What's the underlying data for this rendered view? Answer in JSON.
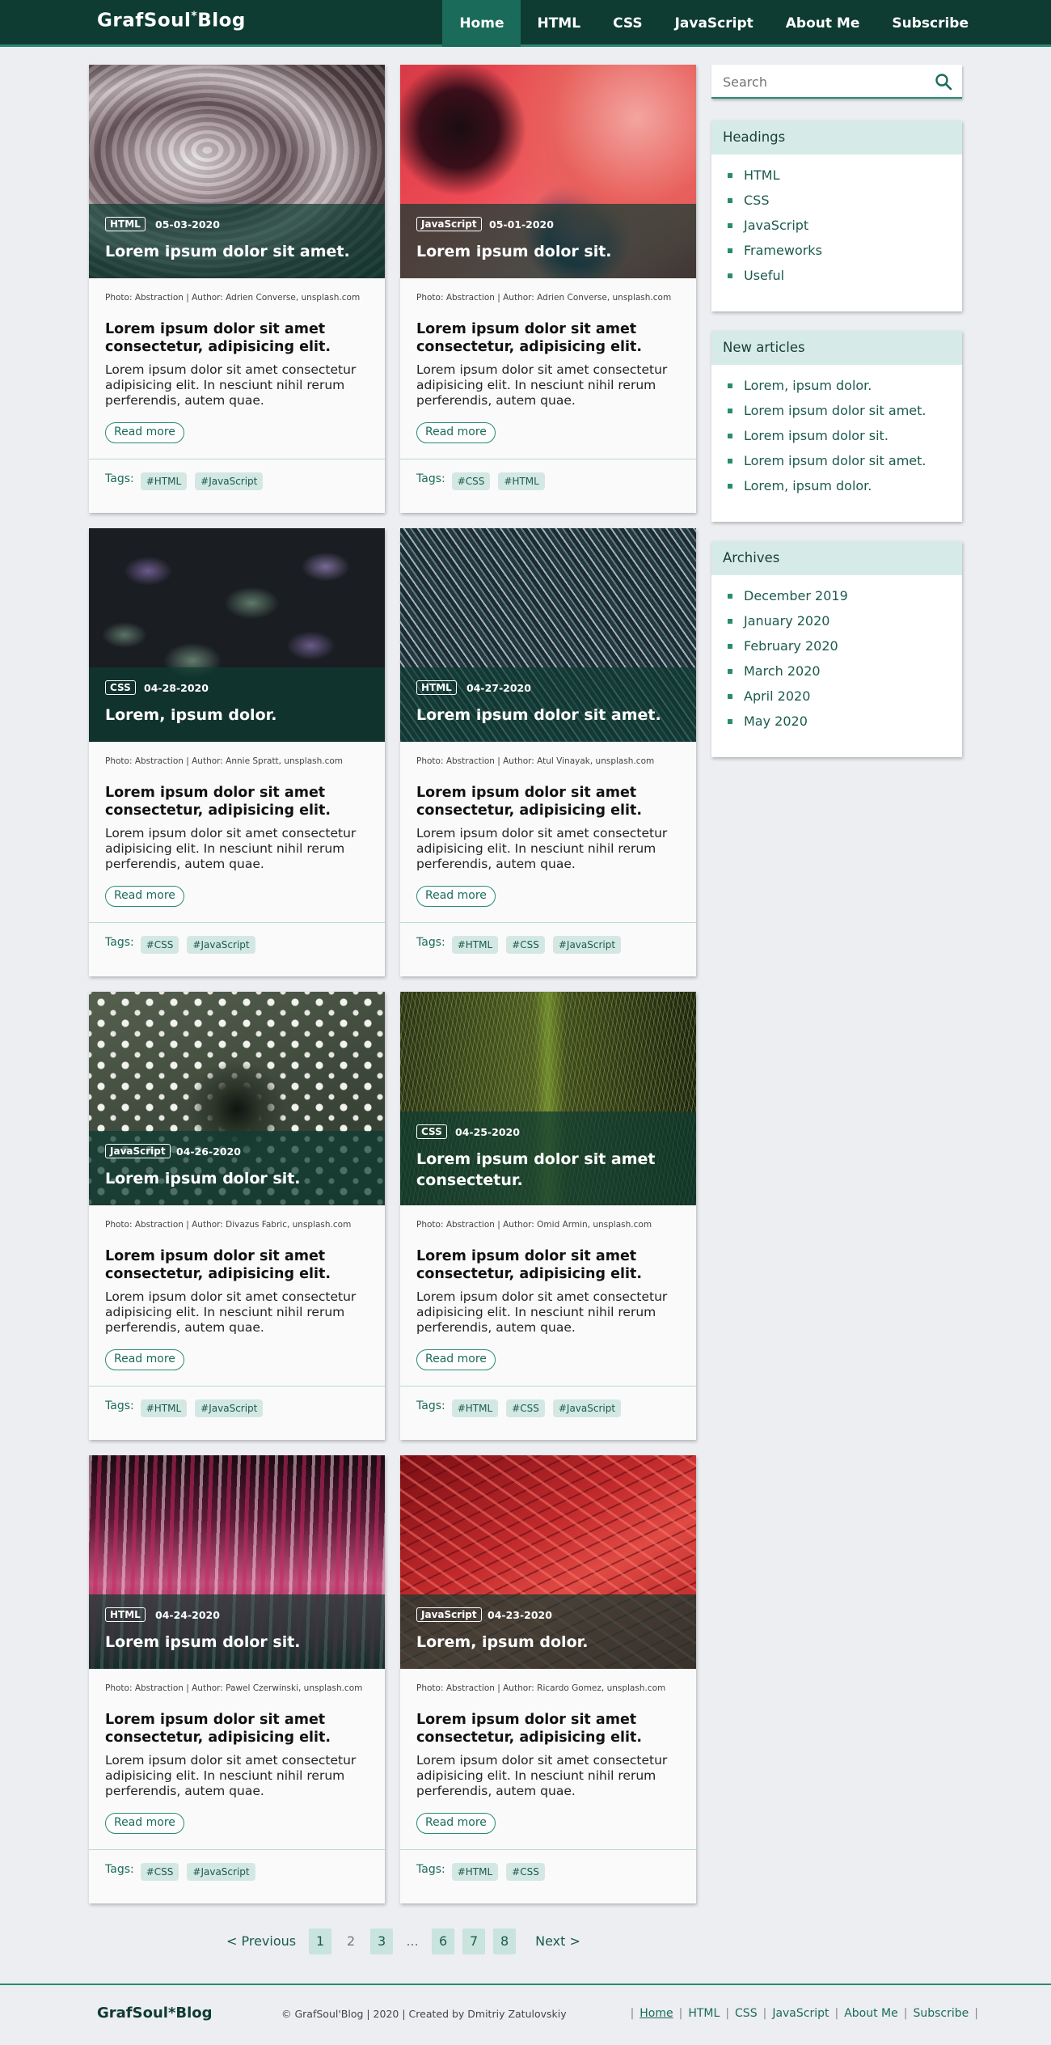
{
  "header": {
    "logo": "GrafSoul",
    "logo_mark": "*",
    "logo_suffix": "Blog",
    "nav": [
      "Home",
      "HTML",
      "CSS",
      "JavaScript",
      "About Me",
      "Subscribe"
    ]
  },
  "search": {
    "placeholder": "Search"
  },
  "cards": [
    {
      "tag": "HTML",
      "date": "05-03-2020",
      "title": "Lorem ipsum dolor sit amet.",
      "credit": "Photo: Abstraction | Author: Adrien Converse, unsplash.com",
      "subtitle": "Lorem ipsum dolor sit amet consectetur, adipisicing elit.",
      "body": "Lorem ipsum dolor sit amet consectetur adipisicing elit. In nesciunt nihil rerum perferendis, autem quae.",
      "read_more": "Read more",
      "tags_label": "Tags:",
      "tags": [
        "#HTML",
        "#JavaScript"
      ]
    },
    {
      "tag": "JavaScript",
      "date": "05-01-2020",
      "title": "Lorem ipsum dolor sit.",
      "credit": "Photo: Abstraction | Author: Adrien Converse, unsplash.com",
      "subtitle": "Lorem ipsum dolor sit amet consectetur, adipisicing elit.",
      "body": "Lorem ipsum dolor sit amet consectetur adipisicing elit. In nesciunt nihil rerum perferendis, autem quae.",
      "read_more": "Read more",
      "tags_label": "Tags:",
      "tags": [
        "#CSS",
        "#HTML"
      ]
    },
    {
      "tag": "CSS",
      "date": "04-28-2020",
      "title": "Lorem, ipsum dolor.",
      "credit": "Photo: Abstraction | Author: Annie Spratt, unsplash.com",
      "subtitle": "Lorem ipsum dolor sit amet consectetur, adipisicing elit.",
      "body": "Lorem ipsum dolor sit amet consectetur adipisicing elit. In nesciunt nihil rerum perferendis, autem quae.",
      "read_more": "Read more",
      "tags_label": "Tags:",
      "tags": [
        "#CSS",
        "#JavaScript"
      ]
    },
    {
      "tag": "HTML",
      "date": "04-27-2020",
      "title": "Lorem ipsum dolor sit amet.",
      "credit": "Photo: Abstraction | Author: Atul Vinayak, unsplash.com",
      "subtitle": "Lorem ipsum dolor sit amet consectetur, adipisicing elit.",
      "body": "Lorem ipsum dolor sit amet consectetur adipisicing elit. In nesciunt nihil rerum perferendis, autem quae.",
      "read_more": "Read more",
      "tags_label": "Tags:",
      "tags": [
        "#HTML",
        "#CSS",
        "#JavaScript"
      ]
    },
    {
      "tag": "JavaScript",
      "date": "04-26-2020",
      "title": "Lorem ipsum dolor sit.",
      "credit": "Photo: Abstraction | Author: Divazus Fabric, unsplash.com",
      "subtitle": "Lorem ipsum dolor sit amet consectetur, adipisicing elit.",
      "body": "Lorem ipsum dolor sit amet consectetur adipisicing elit. In nesciunt nihil rerum perferendis, autem quae.",
      "read_more": "Read more",
      "tags_label": "Tags:",
      "tags": [
        "#HTML",
        "#JavaScript"
      ]
    },
    {
      "tag": "CSS",
      "date": "04-25-2020",
      "title": "Lorem ipsum dolor sit amet consectetur.",
      "credit": "Photo: Abstraction | Author: Omid Armin, unsplash.com",
      "subtitle": "Lorem ipsum dolor sit amet consectetur, adipisicing elit.",
      "body": "Lorem ipsum dolor sit amet consectetur adipisicing elit. In nesciunt nihil rerum perferendis, autem quae.",
      "read_more": "Read more",
      "tags_label": "Tags:",
      "tags": [
        "#HTML",
        "#CSS",
        "#JavaScript"
      ]
    },
    {
      "tag": "HTML",
      "date": "04-24-2020",
      "title": "Lorem ipsum dolor sit.",
      "credit": "Photo: Abstraction | Author: Pawel Czerwinski, unsplash.com",
      "subtitle": "Lorem ipsum dolor sit amet consectetur, adipisicing elit.",
      "body": "Lorem ipsum dolor sit amet consectetur adipisicing elit. In nesciunt nihil rerum perferendis, autem quae.",
      "read_more": "Read more",
      "tags_label": "Tags:",
      "tags": [
        "#CSS",
        "#JavaScript"
      ]
    },
    {
      "tag": "JavaScript",
      "date": "04-23-2020",
      "title": "Lorem, ipsum dolor.",
      "credit": "Photo: Abstraction | Author: Ricardo Gomez, unsplash.com",
      "subtitle": "Lorem ipsum dolor sit amet consectetur, adipisicing elit.",
      "body": "Lorem ipsum dolor sit amet consectetur adipisicing elit. In nesciunt nihil rerum perferendis, autem quae.",
      "read_more": "Read more",
      "tags_label": "Tags:",
      "tags": [
        "#HTML",
        "#CSS"
      ]
    }
  ],
  "sidebar": {
    "headings": {
      "title": "Headings",
      "items": [
        "HTML",
        "CSS",
        "JavaScript",
        "Frameworks",
        "Useful"
      ]
    },
    "new_articles": {
      "title": "New articles",
      "items": [
        "Lorem, ipsum dolor.",
        "Lorem ipsum dolor sit amet.",
        "Lorem ipsum dolor sit.",
        "Lorem ipsum dolor sit amet.",
        "Lorem, ipsum dolor."
      ]
    },
    "archives": {
      "title": "Archives",
      "items": [
        "December 2019",
        "January 2020",
        "February 2020",
        "March 2020",
        "April 2020",
        "May 2020"
      ]
    }
  },
  "pagination": {
    "previous": "< Previous",
    "pages": [
      "1",
      "2",
      "3",
      "...",
      "6",
      "7",
      "8"
    ],
    "next": "Next >"
  },
  "footer": {
    "logo": "GrafSoul*Blog",
    "copyright": "© GrafSoul'Blog | 2020 | Created by Dmitriy Zatulovskiy",
    "links": [
      "Home",
      "HTML",
      "CSS",
      "JavaScript",
      "About Me",
      "Subscribe"
    ]
  },
  "colors": {
    "brand": "#0e3b32",
    "accent": "#2a8a72",
    "tag_bg": "#d3e8e3"
  }
}
